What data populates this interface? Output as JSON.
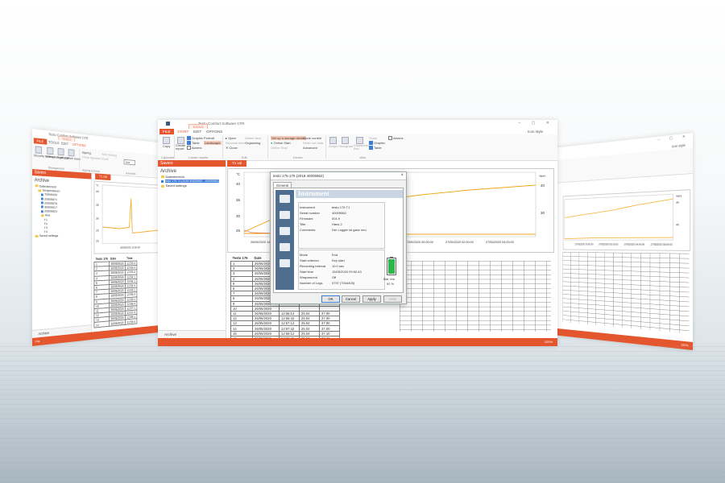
{
  "left_window": {
    "title": "Testo Comfort Software CFR",
    "context_tab": "TOOLS",
    "tabs": [
      "FILE",
      "TOOLS",
      "EDIT",
      "OPTIONS"
    ],
    "ribbon": {
      "items": [
        "Security settings",
        "Users and groups",
        "Audit trail",
        "Web mode",
        "Signing",
        "Check signature",
        "AMS Sharing",
        "Email",
        "Signing process",
        "Automatic"
      ],
      "groups": [
        "Management",
        "Signing process",
        "Automatic"
      ],
      "combo_value": "Axa"
    },
    "sidebar": {
      "header": "Savers",
      "title": "Archive",
      "tree": [
        "Datenbereich",
        "Temperaturen",
        "70000025",
        "20000871",
        "20000876",
        "30000617",
        "20000823",
        "Axa",
        "T1",
        "T2",
        "T3",
        "T4",
        "Saved settings"
      ],
      "footer": "Archive"
    },
    "doc_tab": "T1 val",
    "chart": {
      "y_unit": "°C",
      "ticks_y": [
        "40",
        "35",
        "30",
        "25",
        "20"
      ],
      "x_label": "26/05/2020\n14:00:00"
    },
    "table": {
      "headers": [
        "Testo 175",
        "Date",
        "Time"
      ],
      "rows": [
        [
          "1",
          "26/05/2020",
          "12:53:4"
        ],
        [
          "2",
          "26/05/2020",
          "12:53:4"
        ],
        [
          "3",
          "26/05/2020",
          "12:53:4"
        ],
        [
          "4",
          "26/05/2020",
          "12:54:1"
        ],
        [
          "5",
          "26/05/2020",
          "12:54:1"
        ],
        [
          "6",
          "26/05/2020",
          "12:54:4"
        ],
        [
          "7",
          "26/05/2020",
          "12:55:1"
        ],
        [
          "8",
          "26/05/2020",
          "12:55:4"
        ],
        [
          "9",
          "26/05/2020",
          "12:56:1"
        ],
        [
          "10",
          "26/05/2020",
          "12:56:4"
        ],
        [
          "11",
          "26/05/2020",
          "12:57:1"
        ],
        [
          "12",
          "26/05/2020",
          "12:57:4"
        ],
        [
          "13",
          "26/05/2020",
          "12:58:1"
        ],
        [
          "14",
          "26/05/2020",
          "12:58:4"
        ]
      ]
    },
    "status": "File"
  },
  "center_window": {
    "title": "Testo Comfort Software CFR",
    "context_tab": "TOOLS",
    "tabs": [
      "FILE",
      "START",
      "EDIT",
      "OPTIONS"
    ],
    "style_label": "Icon style",
    "ribbon": {
      "clipboard": [
        "Copy"
      ],
      "create_report": [
        "Create report",
        "Graphic",
        "Table",
        "Alarms",
        "Portrait",
        "Landscape"
      ],
      "edit": [
        "Open",
        "Rename item",
        "Close",
        "Delete item",
        "Organizing"
      ],
      "device": [
        "Set up a storage device",
        "Online Start",
        "Online Stop",
        "Cycle control",
        "Read out data",
        "Advanced"
      ],
      "view": [
        "Graph",
        "Histogram",
        "Dispatcher Box",
        "Scale",
        "Graphic",
        "Table",
        "Alarms"
      ],
      "groups": [
        "Clipboard",
        "Create reports",
        "Edit",
        "Device",
        "View"
      ]
    },
    "sidebar": {
      "header": "Savers",
      "title": "Archive",
      "tree": [
        "Datenbereich",
        "testo 175 T1 [2018 40005962 - 40005962]",
        "Saved settings"
      ],
      "footer": "Archive"
    },
    "doc_tab": "T1 val",
    "chart": {
      "y_unit": "°C",
      "y2_unit": "%rH",
      "ticks_y": [
        "40",
        "35",
        "30",
        "25"
      ],
      "ticks_y2": [
        "40",
        "30"
      ],
      "x_labels": [
        "26/05/2020\n14:00:00",
        "27/05/2020\n00:00:00",
        "27/05/2020\n02:00:00",
        "27/05/2020\n04:00:00"
      ]
    },
    "table": {
      "headers": [
        "Testo 175",
        "Date"
      ],
      "rows": [
        [
          "1",
          "26/05/2020",
          "",
          ""
        ],
        [
          "2",
          "26/05/2020",
          "",
          ""
        ],
        [
          "3",
          "26/05/2020",
          "",
          ""
        ],
        [
          "4",
          "26/05/2020",
          "",
          ""
        ],
        [
          "5",
          "26/05/2020",
          "",
          ""
        ],
        [
          "6",
          "26/05/2020",
          "",
          ""
        ],
        [
          "7",
          "26/05/2020",
          "",
          ""
        ],
        [
          "8",
          "26/05/2020",
          "",
          ""
        ],
        [
          "9",
          "26/05/2020",
          "",
          ""
        ],
        [
          "10",
          "26/05/2020",
          "",
          ""
        ],
        [
          "11",
          "26/05/2020",
          "12:56:13",
          "25.04"
        ],
        [
          "12",
          "26/05/2020",
          "12:56:42",
          "25.04"
        ],
        [
          "13",
          "26/05/2020",
          "12:57:12",
          "25.04"
        ],
        [
          "14",
          "26/05/2020",
          "12:57:42",
          "25.04"
        ],
        [
          "15",
          "26/05/2020",
          "12:58:12",
          "25.04"
        ],
        [
          "16",
          "26/05/2020",
          "12:58:42",
          "25.04"
        ]
      ],
      "extra_col": [
        "37.00",
        "37.00",
        "37.00",
        "37.00",
        "37.10",
        "37.10"
      ]
    },
    "status_zoom": "100%"
  },
  "dialog": {
    "title": "testo 175-176 (2018 40005962)",
    "tab": "General",
    "header": "Instrument",
    "fields": [
      {
        "label": "Instrument",
        "value": "testo 175 T1"
      },
      {
        "label": "Serial number",
        "value": "40005962"
      },
      {
        "label": "Firmware",
        "value": "001.9"
      },
      {
        "label": "Title",
        "value": "Haus 2"
      },
      {
        "label": "Comments",
        "value": "Der Logger ist ganz neu"
      }
    ],
    "fields2": [
      {
        "label": "Mode",
        "value": "End"
      },
      {
        "label": "Start criterion",
        "value": "Key start"
      },
      {
        "label": "Recording interval",
        "value": "10.0 sec"
      },
      {
        "label": "Start time",
        "value": "15/05/2020 09:52:43"
      },
      {
        "label": "Wraparound",
        "value": "Off"
      },
      {
        "label": "Number of Logs",
        "value": "0797 (7044400)"
      }
    ],
    "battery_label": "Bat. res.",
    "battery_value": "92 %",
    "battery_level": 0.92,
    "buttons": [
      "OK",
      "Cancel",
      "Apply",
      "Help"
    ]
  },
  "right_window": {
    "style_label": "Icon style",
    "y2_unit": "%rH",
    "ticks_y2": [
      "40",
      "40"
    ],
    "x_labels": [
      "27/05/2020\n00:00:00",
      "27/05/2020\n02:00:00",
      "27/05/2020\n04:00:00",
      "27/05/2020\n06:00:00"
    ],
    "status_zoom": "100%"
  }
}
